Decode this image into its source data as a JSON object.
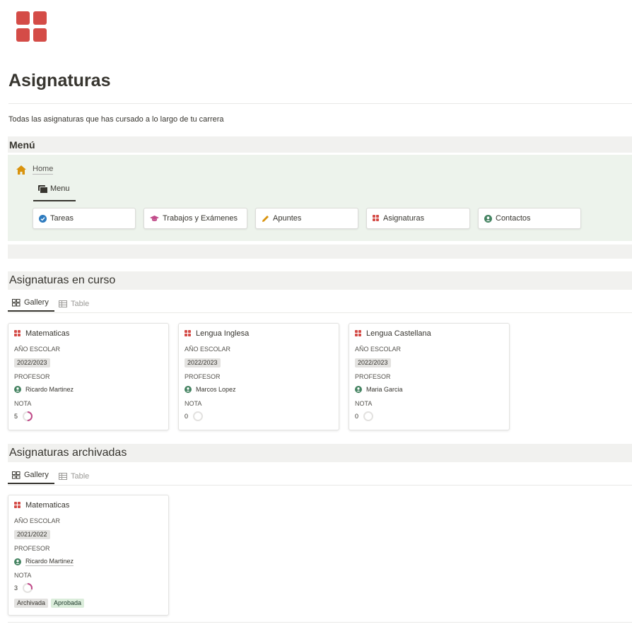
{
  "page": {
    "icon": "grid-icon",
    "title": "Asignaturas",
    "description": "Todas las asignaturas que has cursado a lo largo de tu carrera"
  },
  "menu": {
    "heading": "Menú",
    "breadcrumb": "Home",
    "tab_label": "Menu",
    "buttons": [
      {
        "label": "Tareas",
        "icon": "check-circle-icon"
      },
      {
        "label": "Trabajos y Exámenes",
        "icon": "graduation-cap-icon"
      },
      {
        "label": "Apuntes",
        "icon": "pencil-icon"
      },
      {
        "label": "Asignaturas",
        "icon": "grid-icon"
      },
      {
        "label": "Contactos",
        "icon": "user-circle-icon"
      }
    ]
  },
  "en_curso": {
    "heading": "Asignaturas en curso",
    "views": [
      "Gallery",
      "Table"
    ],
    "cards": [
      {
        "title": "Matematicas",
        "year_label": "AÑO ESCOLAR",
        "year": "2022/2023",
        "prof_label": "PROFESOR",
        "prof": "Ricardo Martinez",
        "nota_label": "NOTA",
        "nota": "5",
        "nota_fraction": 0.5
      },
      {
        "title": "Lengua Inglesa",
        "year_label": "AÑO ESCOLAR",
        "year": "2022/2023",
        "prof_label": "PROFESOR",
        "prof": "Marcos Lopez",
        "nota_label": "NOTA",
        "nota": "0",
        "nota_fraction": 0
      },
      {
        "title": "Lengua Castellana",
        "year_label": "AÑO ESCOLAR",
        "year": "2022/2023",
        "prof_label": "PROFESOR",
        "prof": "Maria Garcia",
        "nota_label": "NOTA",
        "nota": "0",
        "nota_fraction": 0
      }
    ]
  },
  "archivadas": {
    "heading": "Asignaturas archivadas",
    "views": [
      "Gallery",
      "Table"
    ],
    "cards": [
      {
        "title": "Matematicas",
        "year_label": "AÑO ESCOLAR",
        "year": "2021/2022",
        "prof_label": "PROFESOR",
        "prof": "Ricardo Martinez",
        "nota_label": "NOTA",
        "nota": "3",
        "nota_fraction": 0.3,
        "tags": [
          "Archivada",
          "Aprobada"
        ]
      }
    ]
  },
  "colors": {
    "accent_red": "#d44c47",
    "home_orange": "#d9930d",
    "check_blue": "#2e7bbf",
    "person_green": "#448361",
    "cap_pink": "#c14c8a",
    "ring_pink": "#c14c8a"
  }
}
